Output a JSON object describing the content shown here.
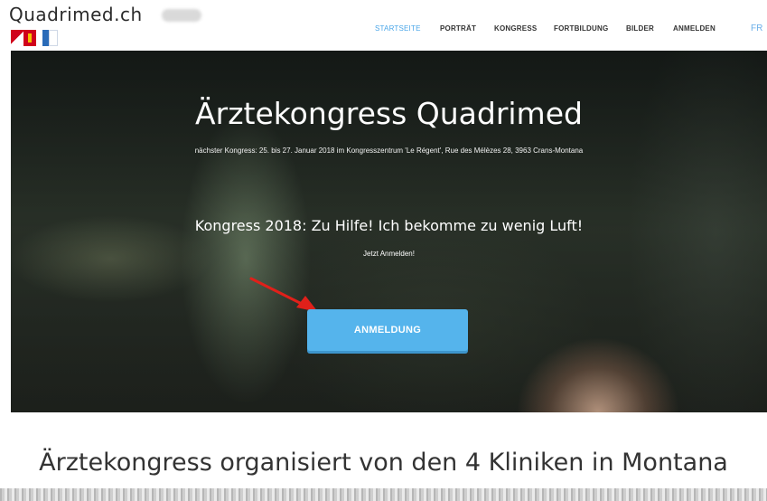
{
  "header": {
    "logo_text": "Quadrimed.ch",
    "nav": [
      {
        "label": "STARTSEITE",
        "active": true
      },
      {
        "label": "PORTRÄT"
      },
      {
        "label": "KONGRESS"
      },
      {
        "label": "FORTBILDUNG"
      },
      {
        "label": "BILDER"
      },
      {
        "label": "ANMELDEN"
      }
    ],
    "lang": "FR"
  },
  "hero": {
    "title": "Ärztekongress Quadrimed",
    "subtitle": "nächster Kongress: 25. bis 27. Januar 2018 im Kongresszentrum 'Le Régent', Rue des Mélèzes 28, 3963 Crans-Montana",
    "heading": "Kongress 2018: Zu Hilfe! Ich bekomme zu wenig Luft!",
    "small": "Jetzt Anmelden!",
    "cta": "ANMELDUNG"
  },
  "section": {
    "title": "Ärztekongress organisiert von den 4 Kliniken in Montana"
  },
  "colors": {
    "accent": "#55b4ec",
    "active_nav": "#4aa6e8",
    "arrow": "#e0201a"
  },
  "icons": [
    "flag-icons",
    "red-arrow-annotation"
  ]
}
